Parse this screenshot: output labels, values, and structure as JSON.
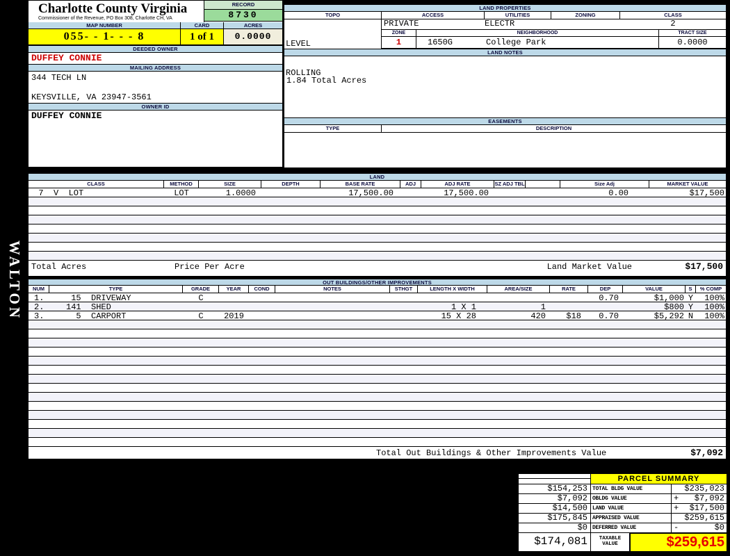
{
  "sidebar": {
    "watermark": "WALTON"
  },
  "header": {
    "county": "Charlotte County Virginia",
    "commissioner_line": "Commissioner of the Revenue, PO Box 308, Charlotte CH, VA",
    "record_label": "RECORD",
    "record_value": "8730",
    "map_number_label": "MAP NUMBER",
    "map_number": "055- - 1- - -  8",
    "card_label": "CARD",
    "card": "1 of 1",
    "acres_label": "ACRES",
    "acres": "0.0000"
  },
  "owner": {
    "deeded_owner_label": "DEEDED OWNER",
    "deeded_owner": "DUFFEY CONNIE",
    "mailing_address_label": "MAILING ADDRESS",
    "address_line1": "344 TECH LN",
    "address_line2": "KEYSVILLE, VA 23947-3561",
    "owner_id_label": "OWNER ID",
    "owner_id": "DUFFEY CONNIE"
  },
  "land_properties": {
    "section_label": "LAND PROPERTIES",
    "col_topo": "TOPO",
    "col_access": "ACCESS",
    "col_utilities": "UTILITIES",
    "col_zoning": "ZONING",
    "col_class": "CLASS",
    "topo1": "LEVEL",
    "topo2": "ROLLING",
    "access": "PRIVATE",
    "utilities": "ELECTR",
    "zoning": "",
    "class": "2",
    "zone_label": "ZONE",
    "zone": "1",
    "zone_code": "1650G",
    "neighborhood_label": "NEIGHBORHOOD",
    "neighborhood": "College Park",
    "tract_size_label": "TRACT SIZE",
    "tract_size": "0.0000"
  },
  "land_notes": {
    "section_label": "LAND NOTES",
    "note": "1.84 Total Acres"
  },
  "easements": {
    "section_label": "EASEMENTS",
    "type_label": "TYPE",
    "description_label": "DESCRIPTION"
  },
  "land_table": {
    "section_label": "LAND",
    "columns": [
      "CLASS",
      "METHOD",
      "SIZE",
      "DEPTH",
      "BASE RATE",
      "ADJ",
      "ADJ RATE",
      "SZ ADJ TBL",
      "",
      "Size Adj",
      "MARKET VALUE"
    ],
    "rows": [
      [
        "  7  V  LOT",
        "LOT",
        "1.0000",
        "",
        "17,500.00",
        "",
        "17,500.00",
        "",
        "",
        "0.00",
        "$17,500"
      ]
    ],
    "footer": {
      "total_acres_label": "Total Acres",
      "price_per_acre_label": "Price Per Acre",
      "land_market_value_label": "Land Market Value",
      "land_market_value": "$17,500"
    }
  },
  "out_buildings": {
    "section_label": "OUT BUILDINGS/OTHER IMPROVEMENTS",
    "columns": [
      "NUM",
      "TYPE",
      "GRADE",
      "YEAR",
      "COND",
      "NOTES",
      "STHGT",
      "LENGTH X WIDTH",
      "AREA/SIZE",
      "RATE",
      "DEP",
      "VALUE",
      "S",
      "% COMP"
    ],
    "rows": [
      [
        "1.",
        " 15  DRIVEWAY",
        "C",
        "",
        "",
        "",
        "",
        "",
        "",
        "",
        "0.70",
        "$1,000",
        "Y",
        "100%"
      ],
      [
        "2.",
        "141  SHED",
        "",
        "",
        "",
        "",
        "",
        "1 X 1",
        "1",
        "",
        "",
        "$800",
        "Y",
        "100%"
      ],
      [
        "3.",
        "  5  CARPORT",
        "C",
        "2019",
        "",
        "",
        "",
        "15 X 28",
        "420",
        "$18",
        "0.70",
        "$5,292",
        "N",
        "100%"
      ]
    ],
    "footer": {
      "label": "Total Out Buildings & Other Improvements Value",
      "value": "$7,092"
    }
  },
  "parcel_summary": {
    "title": "PARCEL SUMMARY",
    "rows": [
      {
        "prior": "$154,253",
        "label": "TOTAL BLDG VALUE",
        "sign": "",
        "value": "$235,023"
      },
      {
        "prior": "$7,092",
        "label": "OBLDG VALUE",
        "sign": "+",
        "value": "$7,092"
      },
      {
        "prior": "$14,500",
        "label": "LAND VALUE",
        "sign": "+",
        "value": "$17,500"
      },
      {
        "prior": "$175,845",
        "label": "APPRAISED VALUE",
        "sign": "",
        "value": "$259,615"
      },
      {
        "prior": "$0",
        "label": "DEFERRED VALUE",
        "sign": "-",
        "value": "$0"
      }
    ],
    "taxable": {
      "prior": "$174,081",
      "label1": "TAXABLE",
      "label2": "VALUE",
      "value": "$259,615"
    }
  },
  "colors": {
    "background": "#000000",
    "band_blue": "#bdd9e8",
    "highlight_yellow": "#ffff00",
    "record_green": "#9bdb9b",
    "record_head_green": "#cde7cd",
    "acres_cream": "#f1eedd",
    "owner_red": "#cc0000",
    "taxable_red": "#e60000",
    "stripe_lavender": "#f3f3fa"
  }
}
